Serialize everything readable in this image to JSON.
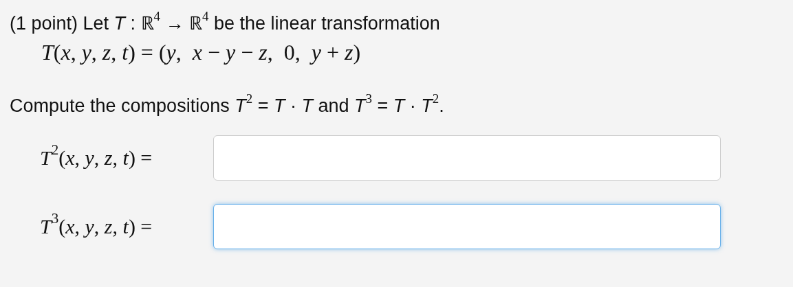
{
  "intro": "(1 point) Let *T* : ℝ$^{4}$ → ℝ$^{4}$ be the linear transformation",
  "formula": "*T*(*x*, *y*, *z*, *t*) = (*y*,  *x* − *y* − *z*,  0,  *y* + *z*)",
  "instruction": "Compute the compositions *T*$^{2}$ = *T* · *T* and *T*$^{3}$ = *T* · *T*$^{2}$.",
  "answers": [
    {
      "label": "*T*$^{2}$(*x*, *y*, *z*, *t*) =",
      "focused": false
    },
    {
      "label": "*T*$^{3}$(*x*, *y*, *z*, *t*) =",
      "focused": true
    }
  ]
}
